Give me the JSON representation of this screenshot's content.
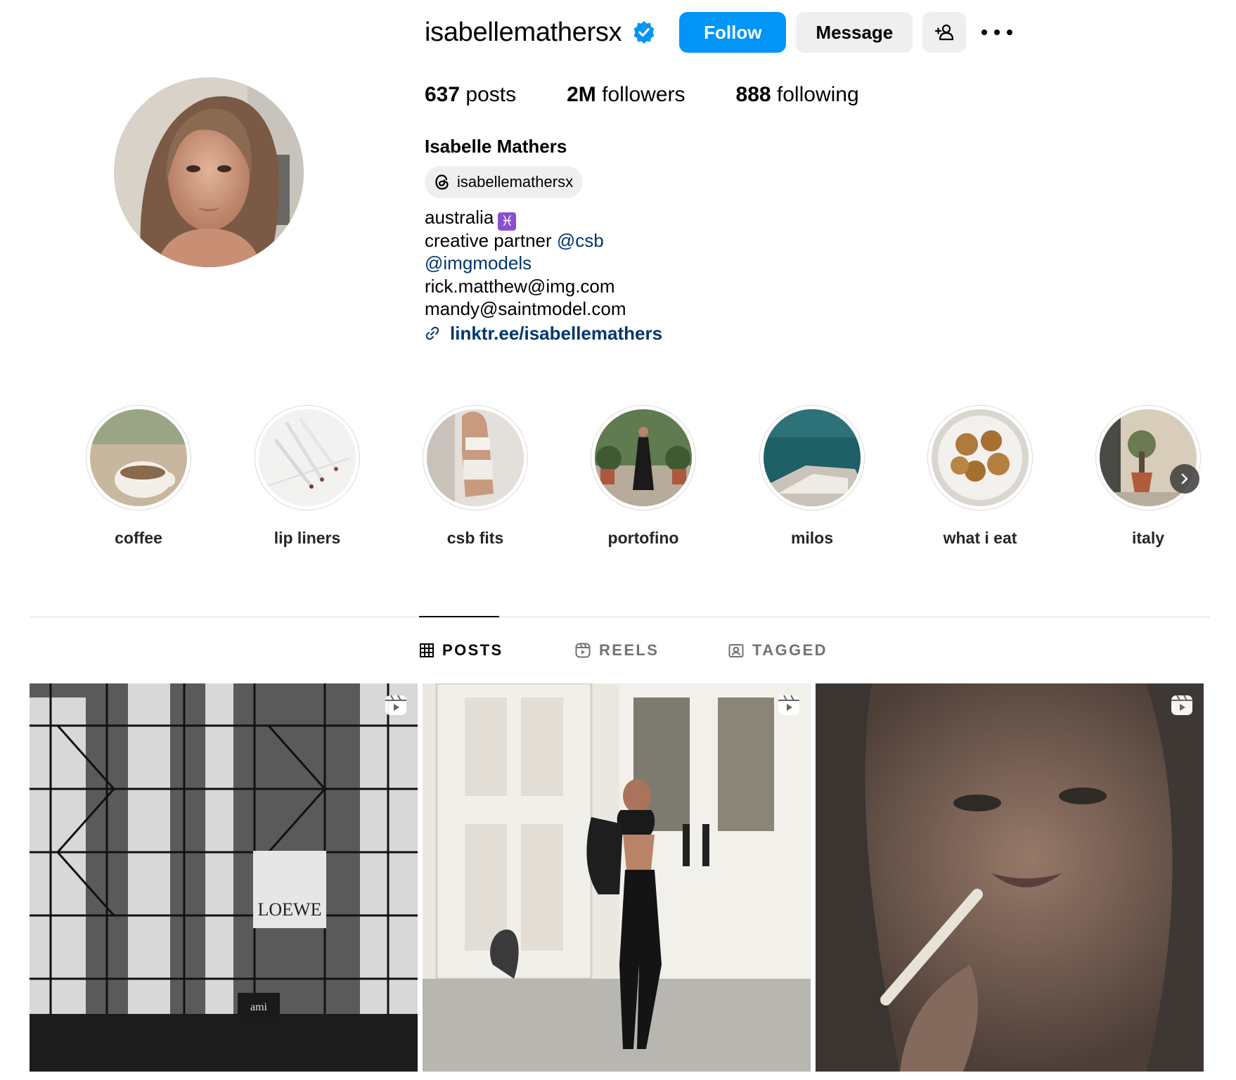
{
  "profile": {
    "username": "isabellemathersx",
    "full_name": "Isabelle Mathers",
    "threads_handle": "isabellemathersx",
    "verified": true,
    "buttons": {
      "follow": "Follow",
      "message": "Message"
    },
    "stats": {
      "posts_count": "637",
      "posts_label": " posts",
      "followers_count": "2M",
      "followers_label": " followers",
      "following_count": "888",
      "following_label": " following"
    },
    "bio": {
      "line1": "australia",
      "line1_emoji": "♓",
      "line2_prefix": "creative partner ",
      "line2_mention": "@csb",
      "line3_mention": "@imgmodels",
      "line4": "rick.matthew@img.com",
      "line5": "mandy@saintmodel.com",
      "link": "linktr.ee/isabellemathers"
    }
  },
  "highlights": [
    {
      "label": "coffee"
    },
    {
      "label": "lip liners"
    },
    {
      "label": "csb fits"
    },
    {
      "label": "portofino"
    },
    {
      "label": "milos"
    },
    {
      "label": "what i eat"
    },
    {
      "label": "italy"
    }
  ],
  "tabs": [
    {
      "label": "POSTS",
      "active": true
    },
    {
      "label": "REELS",
      "active": false
    },
    {
      "label": "TAGGED",
      "active": false
    }
  ],
  "posts": [
    {
      "type": "reel",
      "sign_text": "LOEWE",
      "sign_text_2": "ami"
    },
    {
      "type": "reel"
    },
    {
      "type": "reel"
    }
  ],
  "colors": {
    "accent": "#0095f6",
    "mention": "#00376b",
    "secondary_button": "#efefef",
    "divider": "#dbdbdb",
    "muted_text": "#737373"
  },
  "icons": {
    "verified": "verified-badge-icon",
    "add_user": "add-user-icon",
    "more": "more-options-icon",
    "threads": "threads-icon",
    "link": "link-icon",
    "posts_tab": "grid-icon",
    "reels_tab": "reels-icon",
    "tagged_tab": "tagged-icon",
    "next": "chevron-right-icon"
  }
}
